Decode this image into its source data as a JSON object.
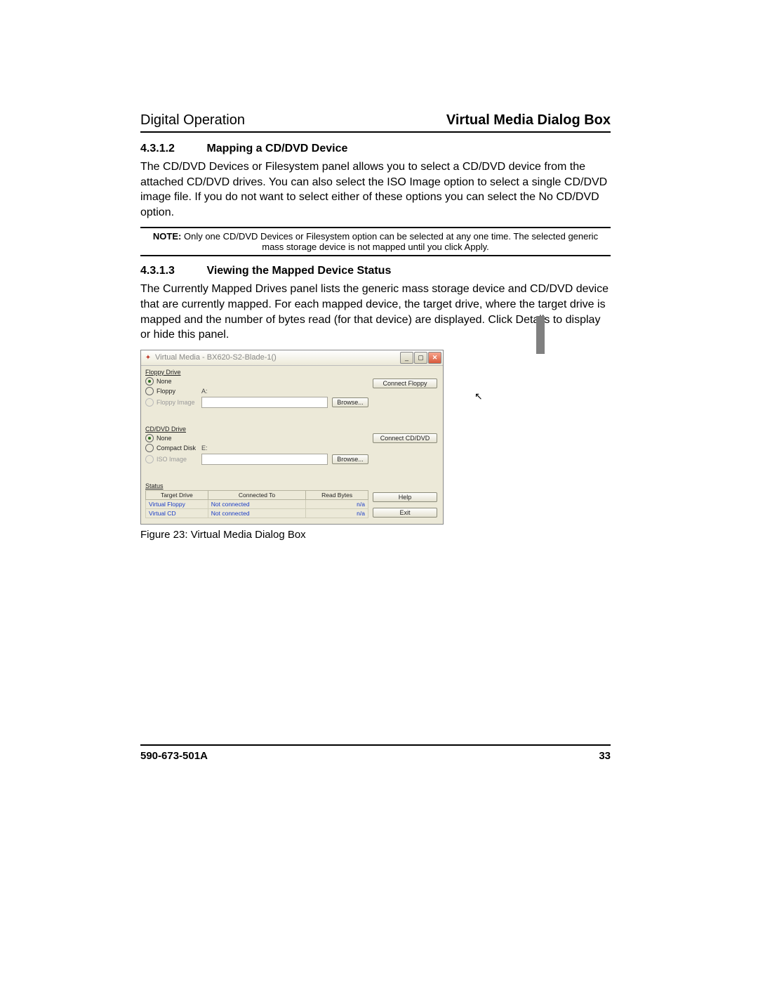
{
  "header": {
    "left": "Digital Operation",
    "right": "Virtual Media Dialog Box"
  },
  "section1": {
    "number": "4.3.1.2",
    "title": "Mapping a CD/DVD Device",
    "body": "The CD/DVD Devices or Filesystem panel allows you to select a CD/DVD device from the attached CD/DVD drives. You can also select the ISO Image option to select a single CD/DVD image file. If you do not want to select either of these options you can select the No CD/DVD option."
  },
  "note": {
    "prefix": "NOTE:",
    "text": " Only one CD/DVD Devices or Filesystem option can be selected at any one time. The selected generic mass storage device is not mapped until you click Apply."
  },
  "section2": {
    "number": "4.3.1.3",
    "title": "Viewing the Mapped Device Status",
    "body": "The Currently Mapped Drives panel lists the generic mass storage device and CD/DVD device that are currently mapped. For each mapped device, the target drive, where the target drive is mapped and the number of bytes read (for that device) are displayed. Click Details to display or hide this panel."
  },
  "dialog": {
    "title": "Virtual Media - BX620-S2-Blade-1()",
    "panels": {
      "floppy": {
        "label": "Floppy Drive",
        "options": {
          "none_label": "None",
          "floppy_label": "Floppy",
          "floppy_drive": "A:",
          "image_label": "Floppy Image",
          "browse_label": "Browse..."
        }
      },
      "cddvd": {
        "label": "CD/DVD Drive",
        "options": {
          "none_label": "None",
          "disk_label": "Compact Disk",
          "disk_drive": "E:",
          "iso_label": "ISO Image",
          "browse_label": "Browse..."
        }
      },
      "status": {
        "label": "Status",
        "headers": {
          "target": "Target Drive",
          "connected": "Connected To",
          "read": "Read Bytes"
        },
        "rows": [
          {
            "target": "Virtual Floppy",
            "connected": "Not connected",
            "read": "n/a"
          },
          {
            "target": "Virtual CD",
            "connected": "Not connected",
            "read": "n/a"
          }
        ]
      }
    },
    "buttons": {
      "connect_floppy": "Connect Floppy",
      "connect_cddvd": "Connect CD/DVD",
      "help": "Help",
      "exit": "Exit"
    }
  },
  "caption": "Figure 23:  Virtual Media Dialog Box",
  "footer": {
    "docnum": "590-673-501A",
    "pagenum": "33"
  }
}
